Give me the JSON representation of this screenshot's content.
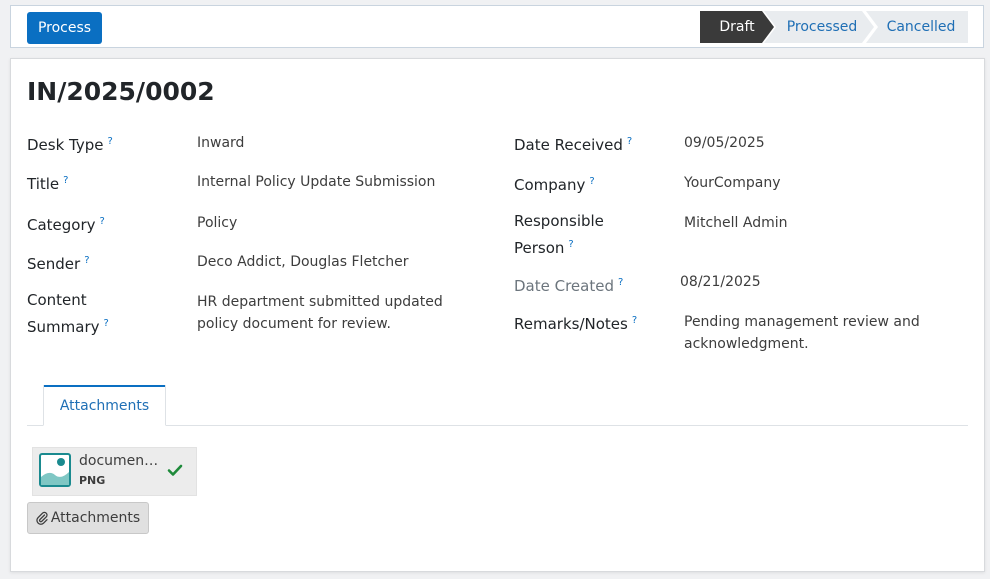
{
  "header": {
    "process_label": "Process",
    "stages": [
      "Draft",
      "Processed",
      "Cancelled"
    ],
    "active_stage": "Draft"
  },
  "record": {
    "title": "IN/2025/0002",
    "help_mark": "?",
    "left_fields": [
      {
        "label": "Desk Type",
        "value": "Inward"
      },
      {
        "label": "Title",
        "value": "Internal Policy Update Submission"
      },
      {
        "label": "Category",
        "value": "Policy"
      },
      {
        "label": "Sender",
        "value": "Deco Addict, Douglas Fletcher"
      },
      {
        "label_line1": "Content",
        "label_line2": "Summary",
        "value_line1": "HR department submitted updated",
        "value_line2": "policy document for review."
      }
    ],
    "right_fields": [
      {
        "label": "Date Received",
        "value": "09/05/2025"
      },
      {
        "label": "Company",
        "value": "YourCompany"
      },
      {
        "label_line1": "Responsible",
        "label_line2": "Person",
        "value": "Mitchell Admin"
      },
      {
        "label": "Date Created",
        "value": "08/21/2025"
      },
      {
        "label": "Remarks/Notes",
        "value_line1": "Pending management review and",
        "value_line2": "acknowledgment."
      }
    ]
  },
  "tabs": {
    "attachments_label": "Attachments"
  },
  "attachment": {
    "name": "documen…",
    "type": "PNG",
    "icon": "image-file-icon",
    "status_icon": "check-icon"
  },
  "attach_button": {
    "label": "Attachments",
    "icon": "paperclip-icon"
  },
  "colors": {
    "primary": "#0a6fc2",
    "active_stage": "#3a3a3a",
    "check": "#1e8a3a",
    "file_icon": "#1a8a8f"
  }
}
